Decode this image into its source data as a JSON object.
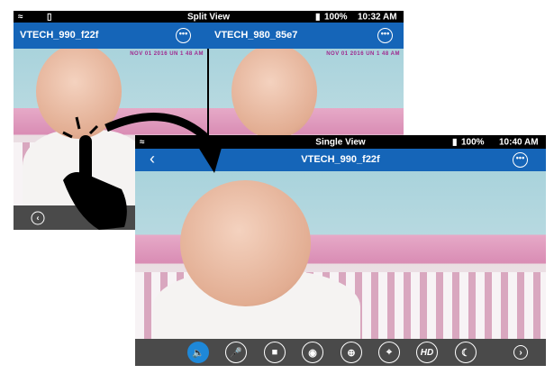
{
  "split": {
    "status_title": "Split View",
    "battery": "100%",
    "time": "10:32 AM",
    "cams": [
      {
        "name": "VTECH_990_f22f",
        "timestamp": "NOV 01 2016 UN 1 48 AM"
      },
      {
        "name": "VTECH_980_85e7",
        "timestamp": "NOV 01 2016 UN 1 48 AM"
      }
    ]
  },
  "single": {
    "status_title": "Single View",
    "battery": "100%",
    "time": "10:40 AM",
    "camera_name": "VTECH_990_f22f",
    "toolbar": [
      {
        "icon": "speaker-icon",
        "active": true
      },
      {
        "icon": "mic-muted-icon"
      },
      {
        "icon": "video-record-icon"
      },
      {
        "icon": "camera-snapshot-icon"
      },
      {
        "icon": "zoom-in-icon"
      },
      {
        "icon": "target-pan-icon"
      },
      {
        "icon": "hd-icon",
        "label": "HD"
      },
      {
        "icon": "night-mode-icon"
      }
    ]
  },
  "colors": {
    "header": "#1565b8",
    "toolbar": "#4a4a4a",
    "active": "#1e88d8"
  }
}
